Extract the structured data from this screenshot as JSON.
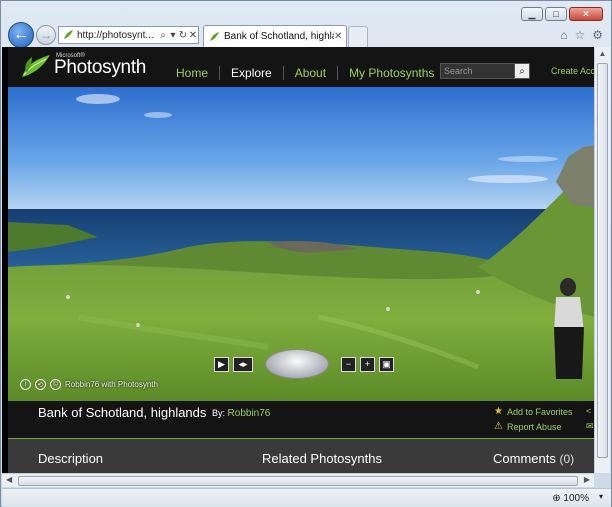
{
  "browser": {
    "address_url": "http://photosynt...",
    "tab_title": "Bank of Schotland, highlan...",
    "zoom": "100%",
    "window_buttons": [
      "minimize",
      "maximize",
      "close"
    ],
    "toolbar_icons": [
      "home-icon",
      "star-icon",
      "gear-icon"
    ]
  },
  "site": {
    "brand_small": "Microsoft®",
    "brand": "Photosynth",
    "nav": [
      {
        "label": "Home"
      },
      {
        "label": "Explore"
      },
      {
        "label": "About"
      },
      {
        "label": "My Photosynths"
      }
    ],
    "active_nav": "Explore",
    "search_placeholder": "Search",
    "create_account": "Create Acco"
  },
  "viewer": {
    "credit": "Robbin76 with Photosynth"
  },
  "synth": {
    "title": "Bank of Schotland, highlands",
    "by_label": "By:",
    "author": "Robbin76",
    "add_favorites": "Add to Favorites",
    "report_abuse": "Report Abuse"
  },
  "tabs": {
    "description": "Description",
    "related": "Related Photosynths",
    "comments": "Comments",
    "comments_count": "(0)"
  },
  "colors": {
    "accent_green": "#9bd25a",
    "header_bg": "#141414"
  }
}
